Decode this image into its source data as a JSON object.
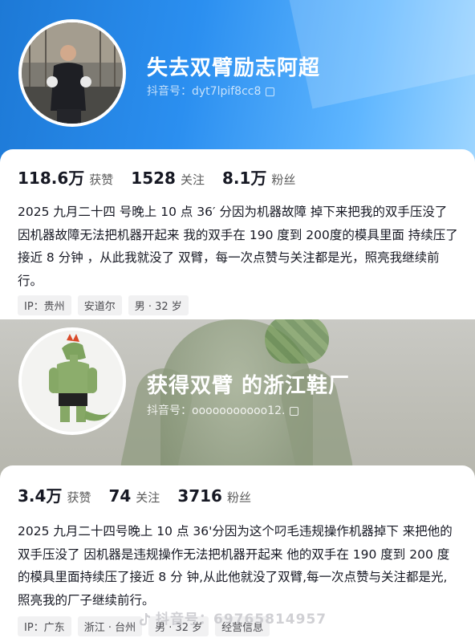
{
  "profiles": [
    {
      "name": "失去双臂励志阿超",
      "uid": "抖音号：dyt7lpif8cc8",
      "stats": [
        {
          "num": "118.6万",
          "label": "获赞"
        },
        {
          "num": "1528",
          "label": "关注"
        },
        {
          "num": "8.1万",
          "label": "粉丝"
        }
      ],
      "bio": "2025 九月二十四 号晚上 10 点 36′ 分因为机器故障 掉下来把我的双手压没了 因机器故障无法把机器开起来 我的双手在 190 度到 200度的模具里面 持续压了 接近 8 分钟 ，从此我就没了 双臂，每一次点赞与关注都是光，照亮我继续前行。",
      "tags": [
        "IP：贵州",
        "安道尔",
        "男 · 32 岁"
      ],
      "accent": "#2b8ff0"
    },
    {
      "name": "获得双臂 的浙江鞋厂",
      "uid": "抖音号：ooooooooooo12.",
      "stats": [
        {
          "num": "3.4万",
          "label": "获赞"
        },
        {
          "num": "74",
          "label": "关注"
        },
        {
          "num": "3716",
          "label": "粉丝"
        }
      ],
      "bio": "2025 九月二十四号晚上 10 点 36'分因为这个叼毛违规操作机器掉下 来把他的双手压没了 因机器是违规操作无法把机器开起来 他的双手在 190 度到 200 度的模具里面持续压了接近 8 分 钟,从此他就没了双臂,每一次点赞与关注都是光, 照亮我的厂子继续前行。",
      "tags": [
        "IP：广东",
        "浙江 · 台州",
        "男 · 32 岁",
        "经营信息"
      ],
      "accent": "#7c8a6c"
    }
  ],
  "watermark": "抖音号：69765814957",
  "icons": {
    "copy": "copy-icon",
    "douyin": "douyin-logo-icon"
  }
}
